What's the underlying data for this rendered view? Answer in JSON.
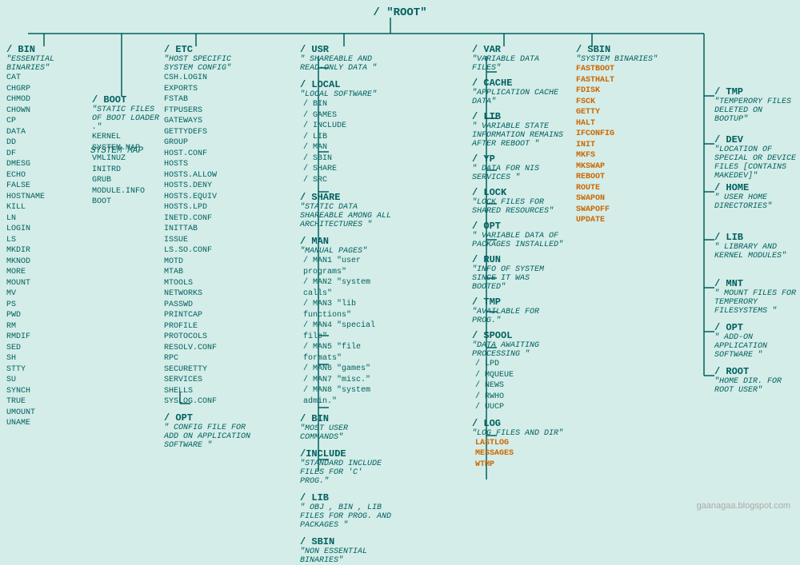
{
  "title": "/    \"ROOT\"",
  "watermark": "gaanagaa.blogspot.com",
  "columns": {
    "bin": {
      "name": "/ BIN",
      "desc": "\"ESSENTIAL BINARIES\"",
      "files": [
        "CAT",
        "CHGRP",
        "CHMOD",
        "CHOWN",
        "CP",
        "DATA",
        "DD",
        "DF",
        "DMESG",
        "ECHO",
        "FALSE",
        "HOSTNAME",
        "KILL",
        "LN",
        "LOGIN",
        "LS",
        "MKDIR",
        "MKNOD",
        "MORE",
        "MOUNT",
        "MV",
        "PS",
        "PWD",
        "RM",
        "RMDIF",
        "SED",
        "SH",
        "STTY",
        "SU",
        "SYNCH",
        "TRUE",
        "UMOUNT",
        "UNAME"
      ]
    },
    "etc": {
      "name": "/ ETC",
      "desc": "\"HOST SPECIFIC SYSTEM CONFIG\"",
      "files": [
        "CSH.LOGIN",
        "EXPORTS",
        "FSTAB",
        "FTPUSERS",
        "GATEWAYS",
        "GETTYDEFS",
        "GROUP",
        "HOST.CONF",
        "HOSTS",
        "HOSTS.ALLOW",
        "HOSTS.DENY",
        "HOSTS.EQUIV",
        "HOSTS.LPD",
        "INETD.CONF",
        "INITTAB",
        "ISSUE",
        "LS.SO.CONF",
        "MOTD",
        "MTAB",
        "MTOOLS",
        "NETWORKS",
        "PASSWD",
        "PRINTCAP",
        "PROFILE",
        "PROTOCOLS",
        "RESOLV.CONF",
        "RPC",
        "SECURETTY",
        "SERVICES",
        "SHELLS",
        "SYSLOG.CONF"
      ],
      "opt": {
        "name": "/ OPT",
        "desc": "\" CONFIG FILE FOR ADD ON APPLICATION SOFTWARE \""
      }
    },
    "boot": {
      "name": "/ BOOT",
      "desc": "\"STATIC FILES OF BOOT LOADER .\"",
      "files": [
        "KERNEL",
        "SYSTEM.MAP",
        "VMLINUZ",
        "INITRD",
        "GRUB",
        "MODULE.INFO",
        "BOOT"
      ]
    },
    "usr": {
      "name": "/ USR",
      "desc": "\" SHAREABLE AND READ-ONLY DATA \"",
      "local": {
        "name": "/ LOCAL",
        "desc": "\"LOCAL SOFTWARE\"",
        "subdirs": [
          "/ BIN",
          "/ GAMES",
          "/ INCLUDE",
          "/ LIB",
          "/ MAN",
          "/ SBIN",
          "/ SHARE",
          "/ SRC"
        ]
      },
      "share": {
        "name": "/ SHARE",
        "desc": "\"STATIC DATA SHAREABLE AMONG ALL ARCHITECTURES \""
      },
      "man": {
        "name": "/ MAN",
        "desc": "\"MANUAL PAGES\"",
        "subdirs": [
          "/ MAN1 \"user programs\"",
          "/ MAN2 \"system calls\"",
          "/ MAN3 \"lib functions\"",
          "/ MAN4 \"special file\"",
          "/ MAN5 \"file formats\"",
          "/ MAN6 \"games\"",
          "/ MAN7 \"misc.\"",
          "/ MAN8 \"system admin.\""
        ]
      },
      "bin": {
        "name": "/ BIN",
        "desc": "\"MOST USER COMMANDS\""
      },
      "include": {
        "name": "/INCLUDE",
        "desc": "\"STANDARD INCLUDE FILES FOR 'C' PROG.\""
      },
      "lib": {
        "name": "/ LIB",
        "desc": "\" OBJ , BIN , LIB FILES FOR PROG. AND PACKAGES \""
      },
      "sbin": {
        "name": "/ SBIN",
        "desc": "\"NON ESSENTIAL BINARIES\""
      }
    },
    "var": {
      "name": "/ VAR",
      "desc": "\"VARIABLE DATA FILES\"",
      "cache": {
        "name": "/ CACHE",
        "desc": "\"APPLICATION CACHE DATA\""
      },
      "lib": {
        "name": "/ LIB",
        "desc": "\" VARIABLE STATE INFORMATION REMAINS AFTER REBOOT \""
      },
      "yp": {
        "name": "/ YP",
        "desc": "\" DATA FOR NIS SERVICES \""
      },
      "lock": {
        "name": "/ LOCK",
        "desc": "\"LOCK FILES FOR SHARED RESOURCES\""
      },
      "opt": {
        "name": "/ OPT",
        "desc": "\" VARIABLE DATA OF PACKAGES INSTALLED\""
      },
      "run": {
        "name": "/ RUN",
        "desc": "\"INFO OF SYSTEM SINCE IT WAS BOOTED\""
      },
      "tmp": {
        "name": "/ TMP",
        "desc": "\"AVAILABLE FOR PROG.\""
      },
      "spool": {
        "name": "/ SPOOL",
        "desc": "\"DATA AWAITING PROCESSING \"",
        "subdirs": [
          "/ LPD",
          "/ MQUEUE",
          "/ NEWS",
          "/ RWHO",
          "/ UUCP"
        ]
      },
      "log": {
        "name": "/ LOG",
        "desc": "\"LOG FILES AND DIR\"",
        "files_orange": [
          "LASTLOG",
          "MESSAGES",
          "WTMP"
        ]
      }
    },
    "sbin": {
      "name": "/ SBIN",
      "desc": "\"SYSTEM BINARIES\"",
      "files_orange": [
        "FASTBOOT",
        "FASTHALT",
        "FDISK",
        "FSCK",
        "GETTY",
        "HALT",
        "IFCONFIG",
        "INIT",
        "MKFS",
        "MKSWAP",
        "REBOOT",
        "ROUTE",
        "SWAPON",
        "SWAPOFF",
        "UPDATE"
      ]
    },
    "right": {
      "tmp": {
        "name": "/ TMP",
        "desc": "\"TEMPERORY FILES DELETED ON BOOTUP\""
      },
      "dev": {
        "name": "/ DEV",
        "desc": "\"LOCATION OF SPECIAL OR DEVICE FILES [CONTAINS MAKEDEV]\""
      },
      "home": {
        "name": "/ HOME",
        "desc": "\" USER HOME DIRECTORIES\""
      },
      "lib": {
        "name": "/ LIB",
        "desc": "\"  LIBRARY AND KERNEL MODULES\""
      },
      "mnt": {
        "name": "/ MNT",
        "desc": "\"  MOUNT FILES FOR TEMPERORY FILESYSTEMS \""
      },
      "opt": {
        "name": "/ OPT",
        "desc": "\" ADD-ON APPLICATION SOFTWARE \""
      },
      "root": {
        "name": "/ ROOT",
        "desc": "\"HOME DIR. FOR ROOT USER\""
      }
    }
  }
}
